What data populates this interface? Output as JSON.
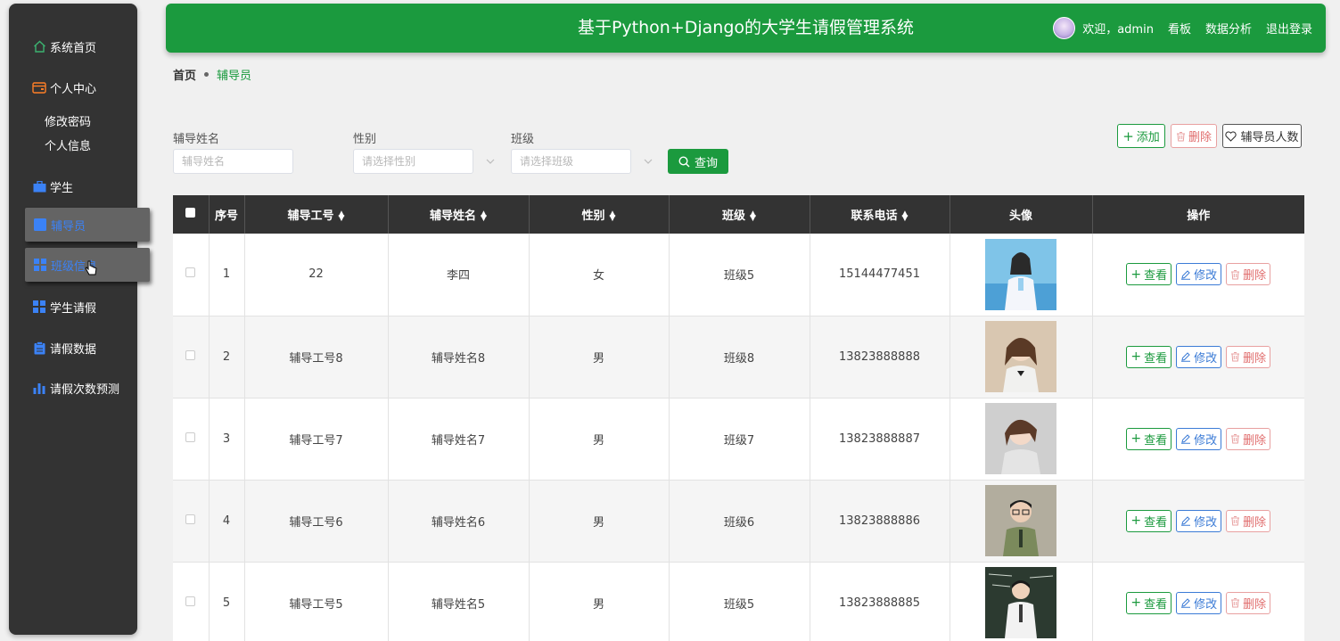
{
  "header": {
    "title": "基于Python+Django的大学生请假管理系统",
    "welcome": "欢迎，admin",
    "links": [
      "看板",
      "数据分析",
      "退出登录"
    ]
  },
  "sidebar": {
    "items": [
      {
        "label": "系统首页",
        "icon": "home-icon",
        "color": "#3cb371"
      },
      {
        "label": "个人中心",
        "icon": "wallet-icon",
        "color": "#ff7f27"
      },
      {
        "label": "学生",
        "icon": "briefcase-icon",
        "color": "#3b82f6"
      },
      {
        "label": "辅导员",
        "icon": "square-icon",
        "color": "#3b82f6"
      },
      {
        "label": "班级信息",
        "icon": "grid-icon",
        "color": "#3b82f6"
      },
      {
        "label": "学生请假",
        "icon": "grid-icon",
        "color": "#3b82f6"
      },
      {
        "label": "请假数据",
        "icon": "clipboard-icon",
        "color": "#3b82f6"
      },
      {
        "label": "请假次数预测",
        "icon": "bar-chart-icon",
        "color": "#3b82f6"
      }
    ],
    "sub_items": [
      "修改密码",
      "个人信息"
    ]
  },
  "breadcrumb": {
    "home": "首页",
    "current": "辅导员"
  },
  "search": {
    "name_label": "辅导姓名",
    "name_placeholder": "辅导姓名",
    "gender_label": "性别",
    "gender_placeholder": "请选择性别",
    "class_label": "班级",
    "class_placeholder": "请选择班级",
    "query_button": "查询"
  },
  "toolbar": {
    "add": "添加",
    "delete": "删除",
    "count": "辅导员人数"
  },
  "table": {
    "headers": [
      "序号",
      "辅导工号",
      "辅导姓名",
      "性别",
      "班级",
      "联系电话",
      "头像",
      "操作"
    ],
    "actions": {
      "view": "查看",
      "edit": "修改",
      "delete": "删除"
    },
    "rows": [
      {
        "index": "1",
        "id": "22",
        "name": "李四",
        "gender": "女",
        "class": "班级5",
        "phone": "15144477451"
      },
      {
        "index": "2",
        "id": "辅导工号8",
        "name": "辅导姓名8",
        "gender": "男",
        "class": "班级8",
        "phone": "13823888888"
      },
      {
        "index": "3",
        "id": "辅导工号7",
        "name": "辅导姓名7",
        "gender": "男",
        "class": "班级7",
        "phone": "13823888887"
      },
      {
        "index": "4",
        "id": "辅导工号6",
        "name": "辅导姓名6",
        "gender": "男",
        "class": "班级6",
        "phone": "13823888886"
      },
      {
        "index": "5",
        "id": "辅导工号5",
        "name": "辅导姓名5",
        "gender": "男",
        "class": "班级5",
        "phone": "13823888885"
      }
    ]
  },
  "colors": {
    "primary": "#1b9a3e",
    "sidebar_bg": "#333333",
    "table_header": "#333333",
    "danger": "#e06c6c",
    "info": "#3b7bd6"
  }
}
